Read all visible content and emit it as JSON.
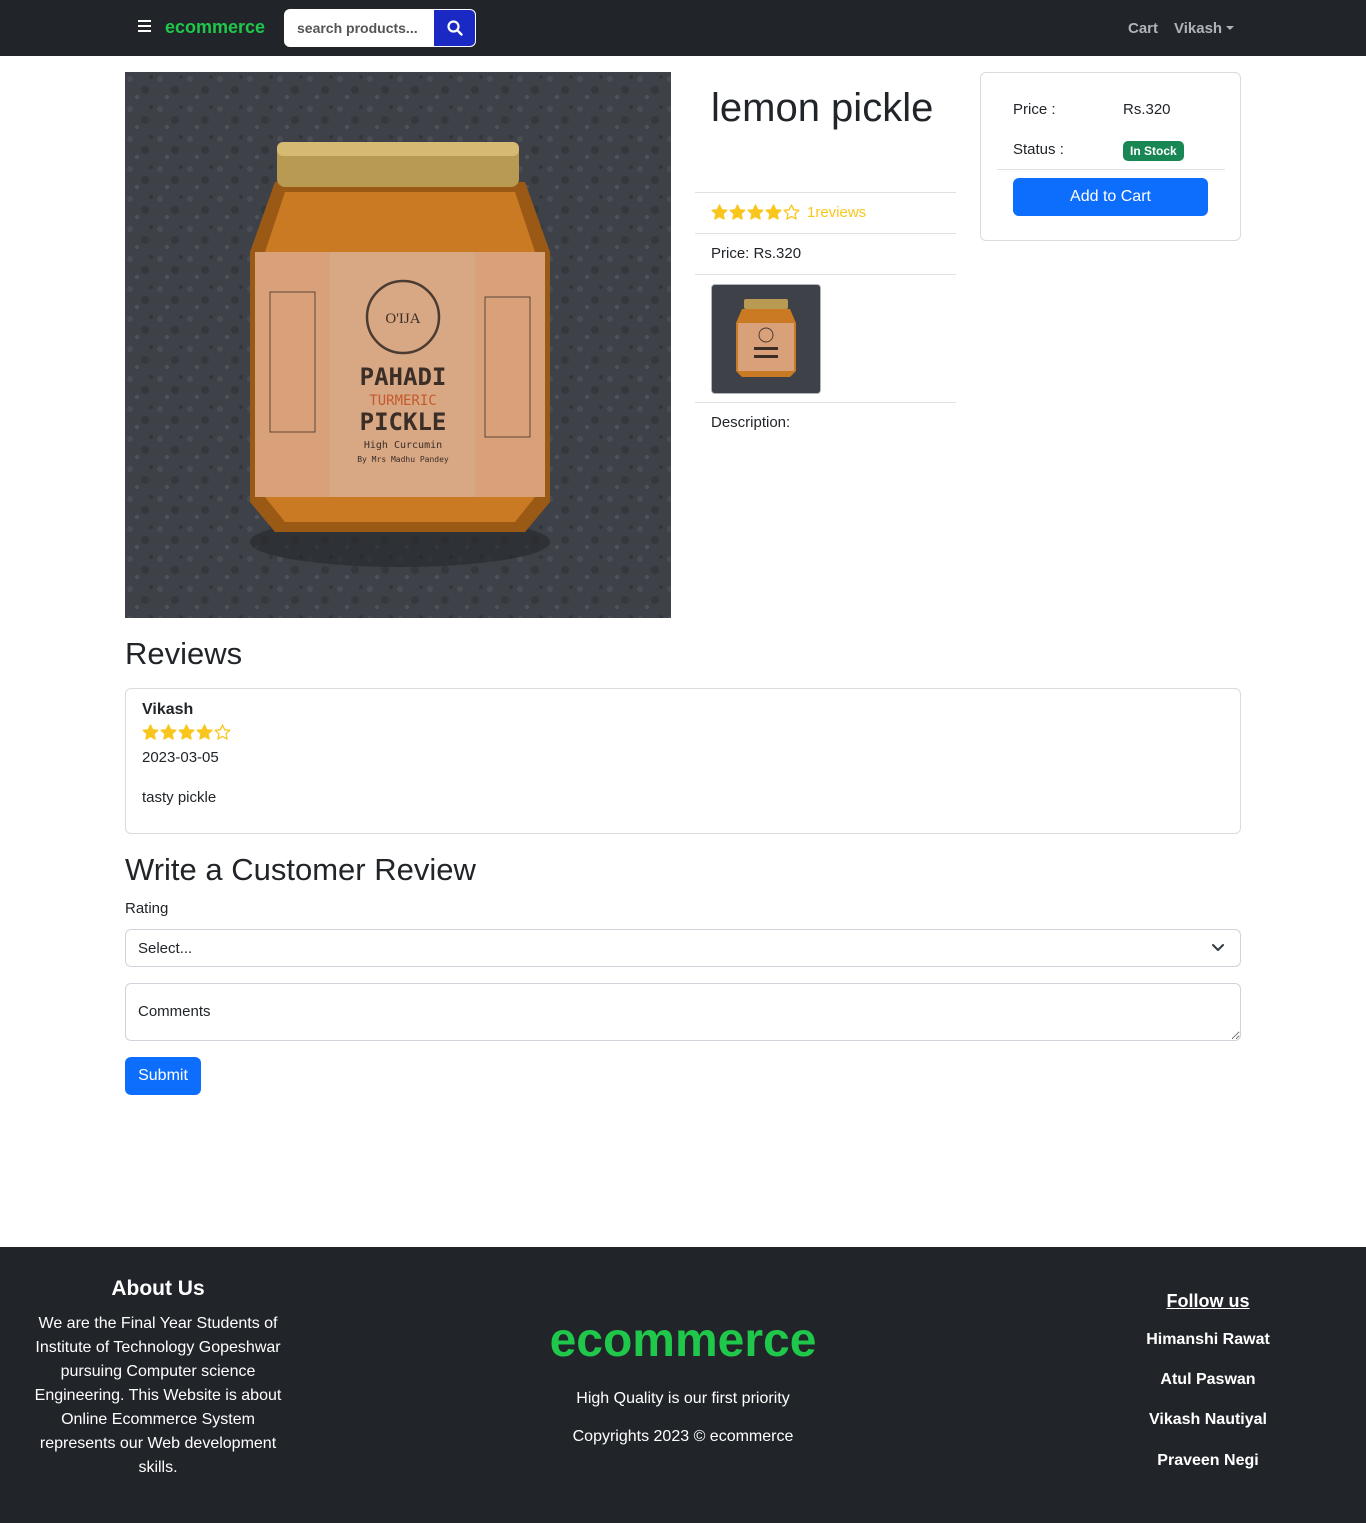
{
  "navbar": {
    "brand": "ecommerce",
    "search_placeholder": "search products...",
    "cart": "Cart",
    "user": "Vikash"
  },
  "product": {
    "title": "lemon pickle",
    "rating": 4,
    "reviews_text": "1reviews",
    "price_line": "Price: Rs.320",
    "description_label": "Description:",
    "jar_label": {
      "brand": "O'IJA",
      "line1": "PAHADI",
      "line2": "TURMERIC",
      "line3": "PICKLE",
      "line4": "High Curcumin",
      "line5": "By Mrs Madhu Pandey"
    }
  },
  "buy_box": {
    "price_label": "Price :",
    "price_value": "Rs.320",
    "status_label": "Status :",
    "status_value": "In Stock",
    "add_button": "Add to Cart"
  },
  "reviews": {
    "heading": "Reviews",
    "items": [
      {
        "name": "Vikash",
        "rating": 4,
        "date": "2023-03-05",
        "comment": "tasty pickle"
      }
    ]
  },
  "write_review": {
    "heading": "Write a Customer Review",
    "rating_label": "Rating",
    "select_value": "Select...",
    "comments_placeholder": "Comments",
    "submit": "Submit"
  },
  "footer": {
    "about_title": "About Us",
    "about_text": "We are the Final Year Students of Institute of Technology Gopeshwar pursuing Computer science Engineering. This Website is about Online Ecommerce System represents our Web development skills.",
    "brand": "ecommerce",
    "tagline": "High Quality is our first priority",
    "copyright": "Copyrights 2023 © ecommerce",
    "follow_title": "Follow us",
    "follow_names": [
      "Himanshi Rawat",
      "Atul Paswan",
      "Vikash Nautiyal",
      "Praveen Negi"
    ]
  },
  "colors": {
    "brand_green": "#1fc84a",
    "primary_blue": "#0d6efd",
    "star_yellow": "#f8c61d",
    "success_badge": "#198754",
    "dark": "#212529"
  }
}
